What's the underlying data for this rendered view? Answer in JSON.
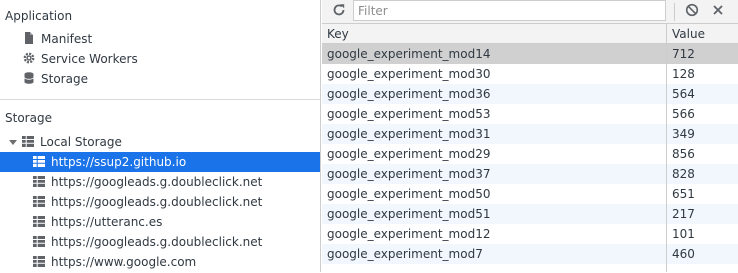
{
  "sidebar": {
    "application_title": "Application",
    "app_items": [
      {
        "label": "Manifest",
        "icon": "document-icon"
      },
      {
        "label": "Service Workers",
        "icon": "gear-icon"
      },
      {
        "label": "Storage",
        "icon": "database-icon"
      }
    ],
    "storage_title": "Storage",
    "local_storage_label": "Local Storage",
    "origins": [
      {
        "label": "https://ssup2.github.io",
        "selected": true
      },
      {
        "label": "https://googleads.g.doubleclick.net"
      },
      {
        "label": "https://googleads.g.doubleclick.net"
      },
      {
        "label": "https://utteranc.es"
      },
      {
        "label": "https://googleads.g.doubleclick.net"
      },
      {
        "label": "https://www.google.com"
      }
    ]
  },
  "toolbar": {
    "refresh_icon": "refresh-icon",
    "filter_placeholder": "Filter",
    "clear_icon": "clear-all-icon",
    "delete_icon": "close-icon"
  },
  "table": {
    "headers": {
      "key": "Key",
      "value": "Value"
    },
    "rows": [
      {
        "key": "google_experiment_mod14",
        "value": "712"
      },
      {
        "key": "google_experiment_mod30",
        "value": "128"
      },
      {
        "key": "google_experiment_mod36",
        "value": "564"
      },
      {
        "key": "google_experiment_mod53",
        "value": "566"
      },
      {
        "key": "google_experiment_mod31",
        "value": "349"
      },
      {
        "key": "google_experiment_mod29",
        "value": "856"
      },
      {
        "key": "google_experiment_mod37",
        "value": "828"
      },
      {
        "key": "google_experiment_mod50",
        "value": "651"
      },
      {
        "key": "google_experiment_mod51",
        "value": "217"
      },
      {
        "key": "google_experiment_mod12",
        "value": "101"
      },
      {
        "key": "google_experiment_mod7",
        "value": "460"
      }
    ]
  },
  "colors": {
    "selected": "#1a73e8",
    "row_selected": "#d0d0d0",
    "row_alt": "#f2f7fd"
  }
}
